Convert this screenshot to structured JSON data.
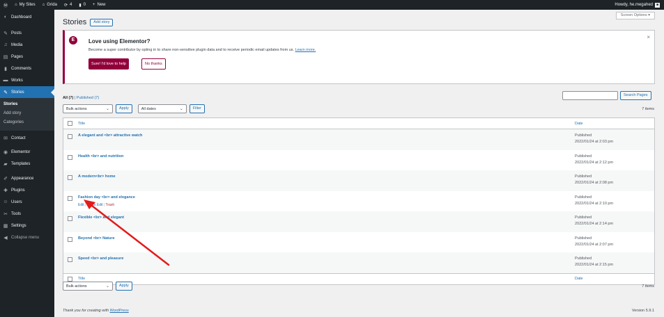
{
  "adminbar": {
    "items": [
      {
        "icon": "wordpress-icon",
        "glyph": "Ⓦ",
        "label": ""
      },
      {
        "icon": "my-sites-icon",
        "glyph": "⌂",
        "label": "My Sites"
      },
      {
        "icon": "home-icon",
        "glyph": "⌂",
        "label": "Grida"
      },
      {
        "icon": "updates-icon",
        "glyph": "⟳",
        "label": "4"
      },
      {
        "icon": "comments-icon",
        "glyph": "▮",
        "label": "0"
      },
      {
        "icon": "plus-icon",
        "glyph": "+",
        "label": "New"
      }
    ],
    "howdy": "Howdy, he.megahed"
  },
  "sidebar": {
    "items": [
      {
        "label": "Dashboard",
        "glyph": "◐",
        "icon": "dashboard-icon"
      },
      {
        "label": "Posts",
        "glyph": "✎",
        "icon": "pin-icon"
      },
      {
        "label": "Media",
        "glyph": "♫",
        "icon": "media-icon"
      },
      {
        "label": "Pages",
        "glyph": "▤",
        "icon": "pages-icon"
      },
      {
        "label": "Comments",
        "glyph": "▮",
        "icon": "comment-icon"
      },
      {
        "label": "Works",
        "glyph": "▬",
        "icon": "works-icon"
      },
      {
        "label": "Stories",
        "glyph": "✎",
        "icon": "stories-icon"
      },
      {
        "label": "Contact",
        "glyph": "✉",
        "icon": "mail-icon"
      },
      {
        "label": "Elementor",
        "glyph": "◉",
        "icon": "elementor-icon"
      },
      {
        "label": "Templates",
        "glyph": "▰",
        "icon": "folder-icon"
      },
      {
        "label": "Appearance",
        "glyph": "✐",
        "icon": "brush-icon"
      },
      {
        "label": "Plugins",
        "glyph": "✚",
        "icon": "plugin-icon"
      },
      {
        "label": "Users",
        "glyph": "☺",
        "icon": "users-icon"
      },
      {
        "label": "Tools",
        "glyph": "✂",
        "icon": "tools-icon"
      },
      {
        "label": "Settings",
        "glyph": "▦",
        "icon": "settings-icon"
      },
      {
        "label": "Collapse menu",
        "glyph": "◀",
        "icon": "collapse-icon"
      }
    ],
    "submenu": [
      "Stories",
      "Add story",
      "Categories"
    ]
  },
  "header": {
    "title": "Stories",
    "add_label": "Add story",
    "screen_options": "Screen Options ▾"
  },
  "notice": {
    "logo": "E",
    "title": "Love using Elementor?",
    "text": "Become a super contributor by opting in to share non-sensitive plugin data and to receive periodic email updates from us.",
    "link": "Learn more.",
    "primary": "Sure! I'd love to help",
    "secondary": "No thanks",
    "close": "×"
  },
  "filters": {
    "all": "All (7)",
    "separator": " | ",
    "published": "Published (7)",
    "search_button": "Search Pages",
    "bulk_actions": "Bulk actions",
    "apply": "Apply",
    "all_dates": "All dates",
    "filter": "Filter",
    "items": "7 items"
  },
  "table": {
    "col_title": "Title",
    "col_date": "Date",
    "rows": [
      {
        "title": "A elegant and <br> attractive watch",
        "status": "Published",
        "date": "2022/01/24 at 2:03 pm"
      },
      {
        "title": "Health <br> and nutrition",
        "status": "Published",
        "date": "2022/01/24 at 2:12 pm"
      },
      {
        "title": "A modern<br> home",
        "status": "Published",
        "date": "2022/01/24 at 2:08 pm"
      },
      {
        "title": "Fashion day <br> and elegance",
        "status": "Published",
        "date": "2022/01/24 at 2:10 pm"
      },
      {
        "title": "Flexible <br> and elegant",
        "status": "Published",
        "date": "2022/01/24 at 2:14 pm"
      },
      {
        "title": "Beyond <br> Nature",
        "status": "Published",
        "date": "2022/01/24 at 2:07 pm"
      },
      {
        "title": "Speed <br> and pleasure",
        "status": "Published",
        "date": "2022/01/24 at 2:15 pm"
      }
    ],
    "row_actions": {
      "edit": "Edit",
      "quick_edit": "Quick Edit",
      "trash": "Trash",
      "sep": " | "
    }
  },
  "footer": {
    "thanks": "Thank you for creating with ",
    "wp_link": "WordPress",
    "version": "Version 5.9.1"
  },
  "colors": {
    "accent": "#2271b1",
    "elementor": "#92003b",
    "sidebar": "#1d2327",
    "annotation_arrow": "#e31b1b"
  }
}
